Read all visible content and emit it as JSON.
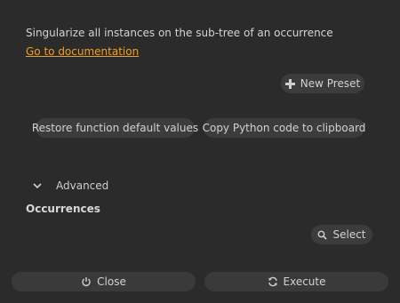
{
  "description": "Singularize all instances on the sub-tree of an occurrence",
  "doc_link": "Go to documentation",
  "presets": {
    "new_preset_label": "New Preset"
  },
  "actions": {
    "restore_label": "Restore function default values",
    "copy_python_label": "Copy Python code to clipboard"
  },
  "advanced": {
    "label": "Advanced"
  },
  "occurrences": {
    "label": "Occurrences",
    "select_label": "Select"
  },
  "footer": {
    "close_label": "Close",
    "execute_label": "Execute"
  },
  "colors": {
    "link": "#f0a020",
    "background": "#2b2b2b",
    "button": "#3c3c3c"
  },
  "icons": [
    "plus-icon",
    "search-icon",
    "power-icon",
    "refresh-icon",
    "chevron-down-icon"
  ]
}
